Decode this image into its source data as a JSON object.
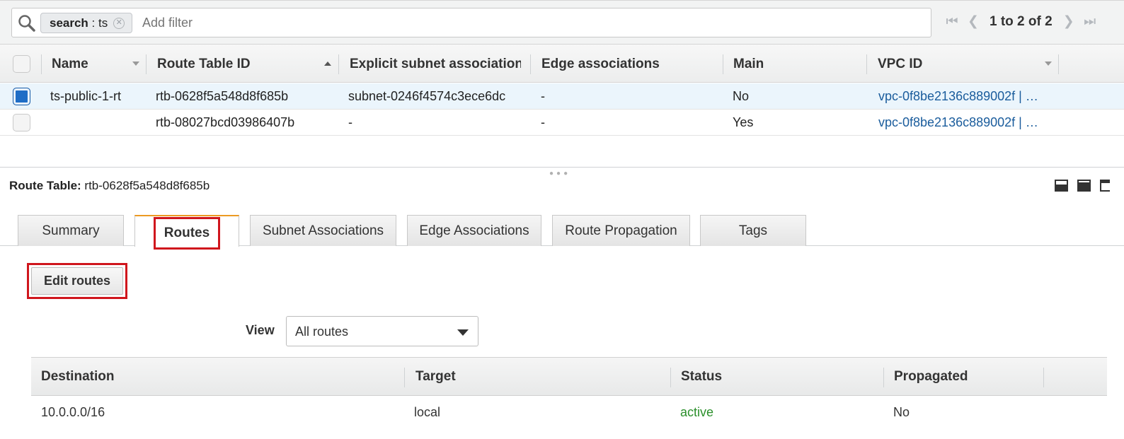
{
  "filter": {
    "chip_key": "search",
    "chip_value": "ts",
    "placeholder": "Add filter"
  },
  "pager": {
    "text": "1 to 2 of 2"
  },
  "upper_table": {
    "columns": [
      "Name",
      "Route Table ID",
      "Explicit subnet association",
      "Edge associations",
      "Main",
      "VPC ID"
    ],
    "rows": [
      {
        "selected": true,
        "name": "ts-public-1-rt",
        "id": "rtb-0628f5a548d8f685b",
        "subnet": "subnet-0246f4574c3ece6dc",
        "edge": "-",
        "main": "No",
        "vpc": "vpc-0f8be2136c889002f | …"
      },
      {
        "selected": false,
        "name": "",
        "id": "rtb-08027bcd03986407b",
        "subnet": "-",
        "edge": "-",
        "main": "Yes",
        "vpc": "vpc-0f8be2136c889002f | …"
      }
    ]
  },
  "detail": {
    "label": "Route Table:",
    "value": "rtb-0628f5a548d8f685b",
    "tabs": [
      "Summary",
      "Routes",
      "Subnet Associations",
      "Edge Associations",
      "Route Propagation",
      "Tags"
    ],
    "active_tab": "Routes",
    "edit_button": "Edit routes",
    "view_label": "View",
    "view_value": "All routes"
  },
  "routes_table": {
    "columns": [
      "Destination",
      "Target",
      "Status",
      "Propagated"
    ],
    "rows": [
      {
        "destination": "10.0.0.0/16",
        "target": "local",
        "status": "active",
        "propagated": "No"
      }
    ]
  },
  "colors": {
    "accent_tab": "#ec9a22",
    "highlight": "#d0161d",
    "link": "#1a5c9c",
    "status_active": "#2a8f2a",
    "selected_row": "#ebf5fc"
  }
}
